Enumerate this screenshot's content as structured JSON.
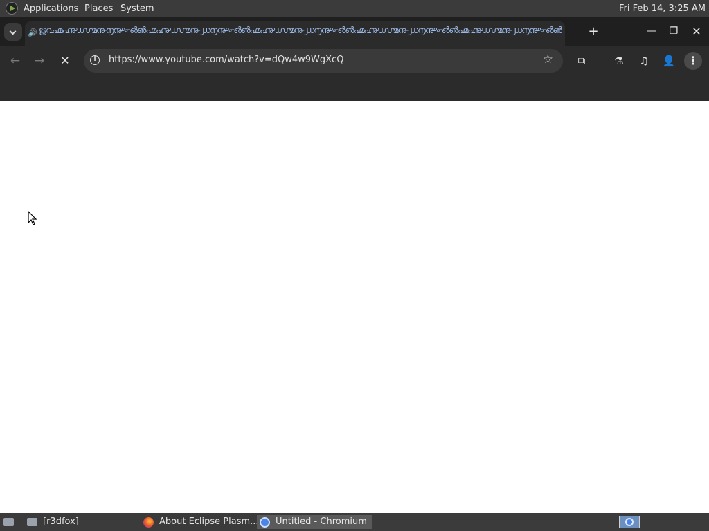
{
  "top_panel": {
    "menus": [
      "Applications",
      "Places",
      "System"
    ],
    "clock": "Fri Feb 14,  3:25 AM"
  },
  "browser": {
    "tab": {
      "title": "ൠ൨൶൷൸൹൱൲൳൴൵൶൷൸൹൰൱൲൳൴൵൶൷൸൹൰൱൲൳൴൵൶൷൸൹൰൱൲൳൴൵൶൷൸൹൰൱൲൳൴൵൶൷൸൹൰൱൲൳൴൵൶൷൸൹൰൱൲൳൴",
      "audio_icon": "speaker-icon"
    },
    "window_buttons": {
      "new_tab": "+",
      "minimize": "—",
      "maximize": "❐",
      "close": "✕"
    },
    "toolbar": {
      "back": "←",
      "forward": "→",
      "stop": "✕",
      "url": "https://www.youtube.com/watch?v=dQw4w9WgXcQ",
      "bookmark_star": "☆",
      "extensions": "⧉",
      "labs": "⚗",
      "media": "♫",
      "profile": "👤",
      "menu": "⋮"
    }
  },
  "taskbar": {
    "items": [
      {
        "label": "[r3dfox]",
        "icon": "folder-icon",
        "active": false
      },
      {
        "label": "About Eclipse Plasm...",
        "icon": "firefox-icon",
        "active": false
      },
      {
        "label": "Untitled - Chromium",
        "icon": "chromium-icon",
        "active": true
      }
    ]
  }
}
